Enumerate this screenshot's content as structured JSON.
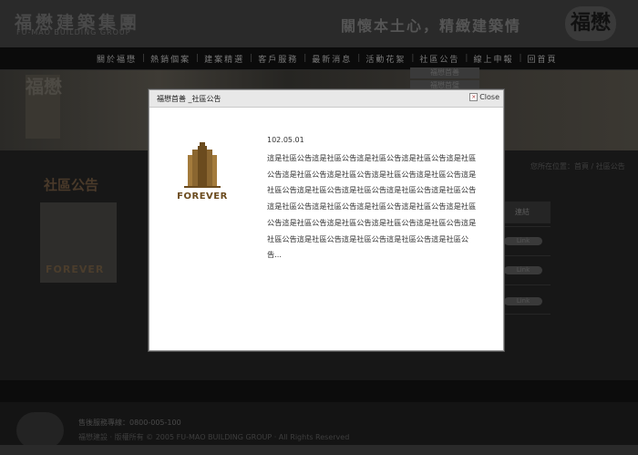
{
  "header": {
    "brand_cn": "福懋建築集團",
    "brand_en": "FU-MAO BUILDING GROUP",
    "slogan": "關懷本土心，精緻建築情",
    "seal_text": "福懋"
  },
  "nav": {
    "items": [
      "關於福懋",
      "熱銷個案",
      "建案精選",
      "客戶服務",
      "最新消息",
      "活動花絮",
      "社區公告",
      "線上申報",
      "回首頁"
    ]
  },
  "banner": {
    "calligraphy": "福懋",
    "submenu": [
      "福懋首善",
      "福懋首璧"
    ]
  },
  "sidebar": {
    "title": "社區公告",
    "logo_text": "FOREVER"
  },
  "breadcrumb": "您所在位置：首頁 / 社區公告",
  "table": {
    "header": "連結",
    "link_label": "Link"
  },
  "footer": {
    "line1": "售後服務專線：0800-005-100",
    "line2": "福懋建設 · 版權所有 © 2005 FU-MAO BUILDING GROUP · All Rights Reserved"
  },
  "modal": {
    "title": "福懋首善 _社區公告",
    "close_label": "Close",
    "date": "102.05.01",
    "body": "這是社區公告這是社區公告這是社區公告這是社區公告這是社區公告這是社區公告這是社區公告這是社區公告這是社區公告這是社區公告這是社區公告這是社區公告這是社區公告這是社區公告這是社區公告這是社區公告這是社區公告這是社區公告這是社區公告這是社區公告這是社區公告這是社區公告這是社區公告這是社區公告這是社區公告這是社區公告這是社區公告這是社區公告...",
    "logo_text": "FOREVER"
  },
  "colors": {
    "accent_gold": "#6b4b1e",
    "modal_bg": "#ffffff",
    "page_bg": "#121212"
  }
}
